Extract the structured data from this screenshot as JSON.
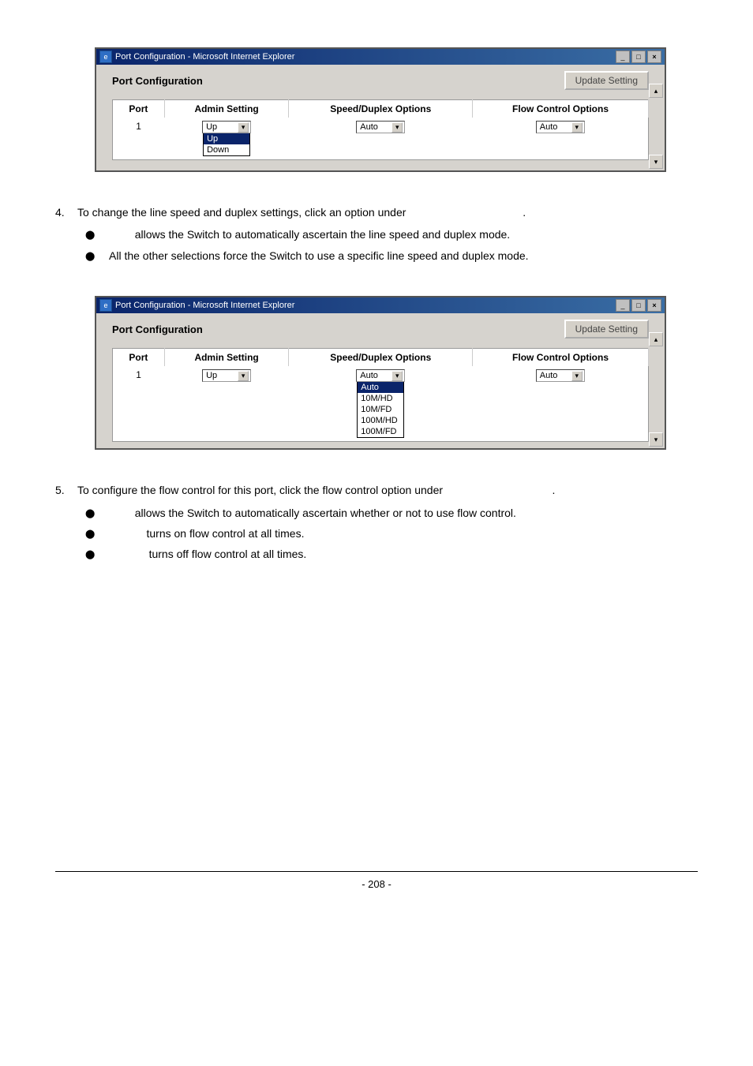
{
  "window1": {
    "title": "Port Configuration - Microsoft Internet Explorer",
    "heading": "Port Configuration",
    "updateBtn": "Update Setting",
    "cols": {
      "port": "Port",
      "admin": "Admin Setting",
      "speed": "Speed/Duplex Options",
      "flow": "Flow Control Options"
    },
    "row": {
      "port": "1",
      "admin": "Up",
      "speed": "Auto",
      "flow": "Auto"
    },
    "adminDropdown": {
      "opt1": "Up",
      "opt2": "Down"
    }
  },
  "window2": {
    "title": "Port Configuration - Microsoft Internet Explorer",
    "heading": "Port Configuration",
    "updateBtn": "Update Setting",
    "cols": {
      "port": "Port",
      "admin": "Admin Setting",
      "speed": "Speed/Duplex Options",
      "flow": "Flow Control Options"
    },
    "row": {
      "port": "1",
      "admin": "Up",
      "speed": "Auto",
      "flow": "Auto"
    },
    "speedDropdown": {
      "opt1": "Auto",
      "opt2": "10M/HD",
      "opt3": "10M/FD",
      "opt4": "100M/HD",
      "opt5": "100M/FD"
    }
  },
  "text": {
    "step4": "To change the line speed and duplex settings, click an option under",
    "step4b1": "allows the Switch to automatically ascertain the line speed and duplex mode.",
    "step4b2": "All the other selections force the Switch to use a specific line speed and duplex mode.",
    "step5": "To configure the flow control for this port, click the flow control option under",
    "step5b1": "allows the Switch to automatically ascertain whether or not to use flow control.",
    "step5b2": "turns on flow control at all times.",
    "step5b3": "turns off flow control at all times.",
    "num4": "4.",
    "num5": "5.",
    "period": "."
  },
  "footer": {
    "pageNum": "- 208 -"
  }
}
